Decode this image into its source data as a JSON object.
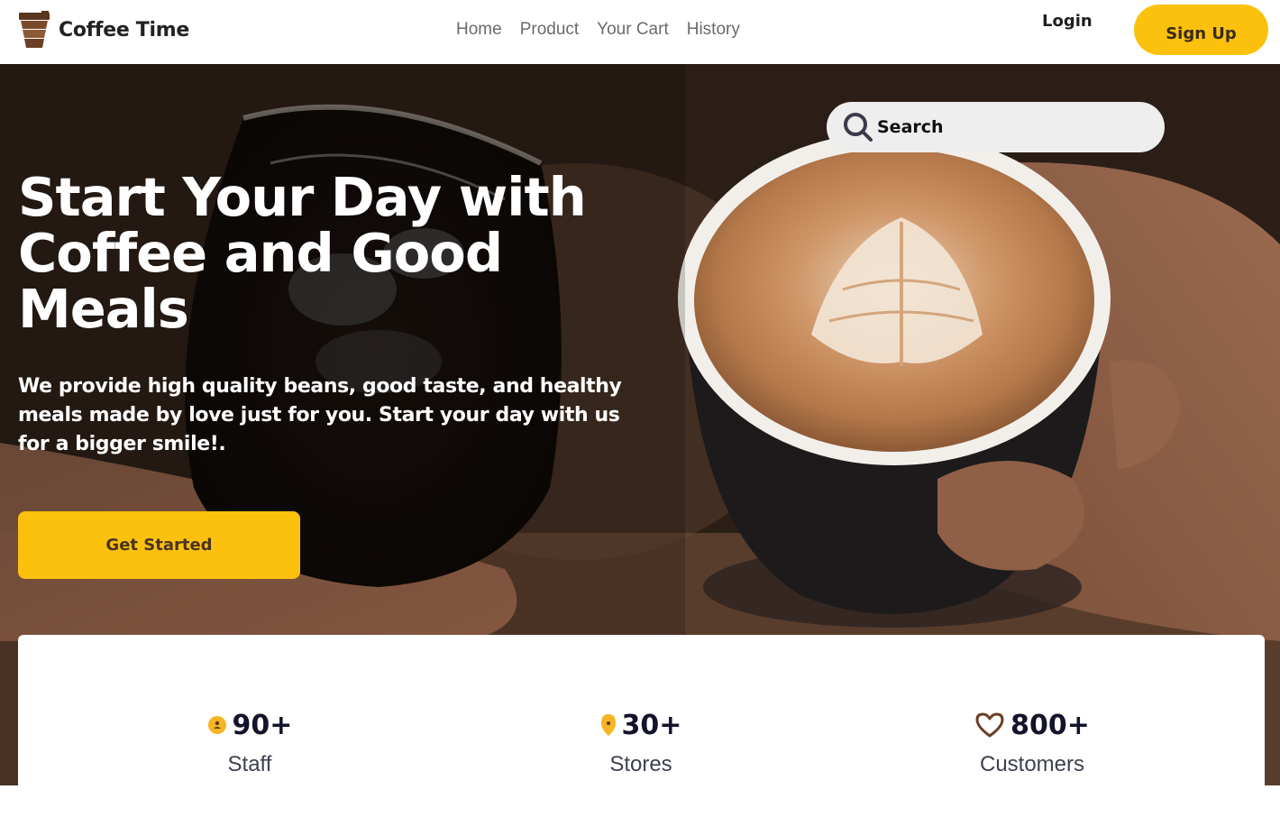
{
  "brand": {
    "name": "Coffee Time",
    "icon": "coffee-cup-icon"
  },
  "nav": {
    "items": [
      {
        "label": "Home"
      },
      {
        "label": "Product"
      },
      {
        "label": "Your Cart"
      },
      {
        "label": "History"
      }
    ]
  },
  "auth": {
    "login_label": "Login",
    "signup_label": "Sign Up"
  },
  "search": {
    "placeholder": "Search",
    "icon": "search-icon"
  },
  "hero": {
    "title": "Start Your Day with Coffee and Good Meals",
    "subtitle": "We provide high quality beans, good taste, and healthy meals made by love just for you. Start your day with us for a bigger smile!.",
    "cta_label": "Get Started"
  },
  "stats": [
    {
      "value": "90+",
      "label": "Staff",
      "icon": "person-icon"
    },
    {
      "value": "30+",
      "label": "Stores",
      "icon": "location-pin-icon"
    },
    {
      "value": "800+",
      "label": "Customers",
      "icon": "heart-icon"
    }
  ],
  "colors": {
    "accent": "#fbc10d",
    "brand_brown": "#6b3f23",
    "text_dark": "#13132a"
  }
}
